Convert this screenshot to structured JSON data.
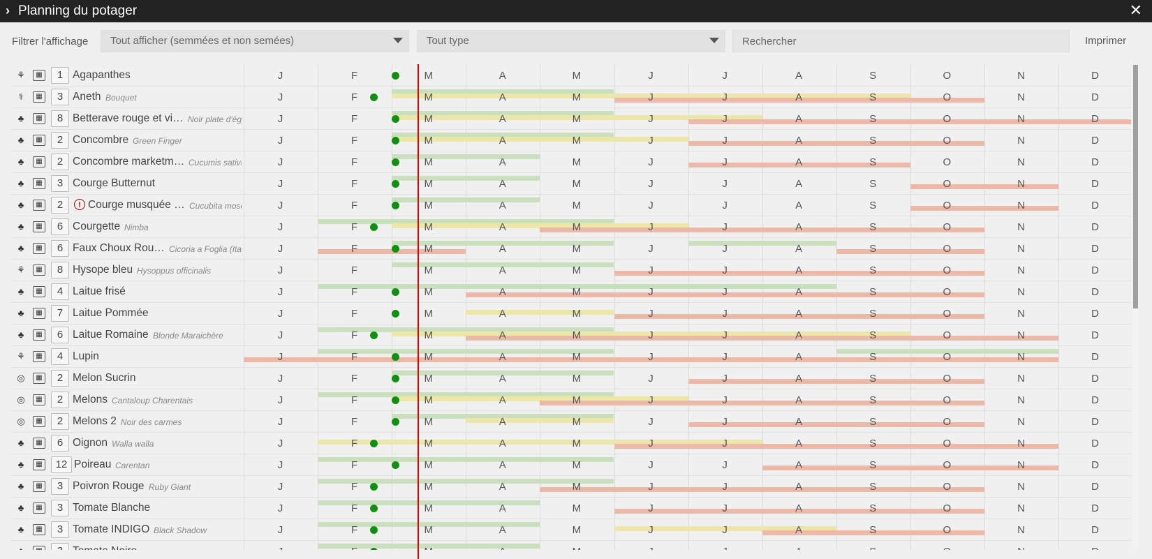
{
  "window": {
    "title": "Planning du potager"
  },
  "toolbar": {
    "filter_label": "Filtrer l'affichage",
    "display_filter": "Tout afficher (semmées et non semées)",
    "type_filter": "Tout type",
    "search_placeholder": "Rechercher",
    "print_label": "Imprimer"
  },
  "months": [
    "J",
    "F",
    "M",
    "A",
    "M",
    "J",
    "J",
    "A",
    "S",
    "O",
    "N",
    "D"
  ],
  "colors": {
    "green": "#c9dfbd",
    "yellow": "#ece6a8",
    "red": "#ecb9a8",
    "dot": "#109010",
    "today_line": "#e00000"
  },
  "icons": {
    "flower": "flower-icon",
    "herb": "herb-icon",
    "veg": "vegetable-icon",
    "melon": "melon-icon",
    "cross": "crossed-vegetable-icon",
    "sheet": "plant-sheet-icon",
    "warn": "warning-icon"
  },
  "rows": [
    {
      "type": "flower",
      "qty": "1",
      "name": "Agapanthes",
      "variety": "",
      "dot": 2,
      "bars": []
    },
    {
      "type": "herb",
      "qty": "3",
      "name": "Aneth",
      "variety": "Bouquet",
      "dot": 1,
      "bars": [
        [
          "g",
          2,
          5,
          1
        ],
        [
          "y",
          2,
          9,
          2
        ],
        [
          "r",
          5,
          10,
          3
        ]
      ]
    },
    {
      "type": "veg",
      "qty": "8",
      "name": "Betterave rouge et vi…",
      "variety": "Noir plate d'égypte",
      "dot": 2,
      "bars": [
        [
          "g",
          2,
          5,
          1
        ],
        [
          "y",
          2,
          7,
          2
        ],
        [
          "r",
          6,
          12,
          3
        ]
      ]
    },
    {
      "type": "veg",
      "qty": "2",
      "name": "Concombre",
      "variety": "Green Finger",
      "dot": 2,
      "bars": [
        [
          "g",
          2,
          5,
          1
        ],
        [
          "y",
          2,
          6,
          2
        ],
        [
          "r",
          6,
          10,
          3
        ]
      ]
    },
    {
      "type": "veg",
      "qty": "2",
      "name": "Concombre marketm…",
      "variety": "Cucumis sativus",
      "dot": 2,
      "bars": [
        [
          "g",
          2,
          4,
          1
        ],
        [
          "r",
          6,
          9,
          3
        ]
      ]
    },
    {
      "type": "veg",
      "qty": "3",
      "name": "Courge Butternut",
      "variety": "",
      "dot": 2,
      "bars": [
        [
          "g",
          2,
          4,
          1
        ],
        [
          "r",
          9,
          11,
          3
        ]
      ]
    },
    {
      "type": "veg",
      "qty": "2",
      "name": "Courge musquée …",
      "variety": "Cucubita moschata",
      "warn": true,
      "dot": 2,
      "bars": [
        [
          "g",
          2,
          4,
          1
        ],
        [
          "r",
          9,
          11,
          3
        ]
      ]
    },
    {
      "type": "veg",
      "qty": "6",
      "name": "Courgette",
      "variety": "Nimba",
      "dot": 1,
      "bars": [
        [
          "g",
          1,
          5,
          1
        ],
        [
          "y",
          2,
          6,
          2
        ],
        [
          "r",
          4,
          10,
          3
        ]
      ]
    },
    {
      "type": "veg",
      "qty": "6",
      "name": "Faux Choux Rou…",
      "variety": "Cicoria a Foglia (Italie)",
      "dot": 2,
      "bars": [
        [
          "g",
          2,
          5,
          1
        ],
        [
          "g",
          6,
          8,
          1
        ],
        [
          "r",
          1,
          3,
          3
        ],
        [
          "r",
          8,
          10,
          3
        ]
      ]
    },
    {
      "type": "flower",
      "qty": "8",
      "name": "Hysope bleu",
      "variety": "Hysoppus officinalis",
      "dot": 0,
      "bars": [
        [
          "g",
          2,
          5,
          1
        ],
        [
          "r",
          5,
          10,
          3
        ]
      ]
    },
    {
      "type": "veg",
      "qty": "4",
      "name": "Laitue frisé",
      "variety": "",
      "dot": 2,
      "bars": [
        [
          "g",
          1,
          8,
          1
        ],
        [
          "r",
          3,
          10,
          3
        ]
      ]
    },
    {
      "type": "cross",
      "qty": "7",
      "name": "Laitue Pommée",
      "variety": "",
      "dot": 2,
      "bars": [
        [
          "y",
          3,
          5,
          2
        ],
        [
          "r",
          5,
          10,
          3
        ]
      ]
    },
    {
      "type": "veg",
      "qty": "6",
      "name": "Laitue Romaine",
      "variety": "Blonde Maraichère",
      "dot": 1,
      "bars": [
        [
          "g",
          1,
          5,
          1
        ],
        [
          "y",
          2,
          9,
          2
        ],
        [
          "r",
          3,
          11,
          3
        ]
      ]
    },
    {
      "type": "flower",
      "qty": "4",
      "name": "Lupin",
      "variety": "",
      "dot": 2,
      "bars": [
        [
          "g",
          1,
          5,
          1
        ],
        [
          "g",
          8,
          11,
          1
        ],
        [
          "r",
          0,
          11,
          3
        ]
      ]
    },
    {
      "type": "melon",
      "qty": "2",
      "name": "Melon Sucrin",
      "variety": "",
      "dot": 2,
      "bars": [
        [
          "g",
          2,
          5,
          1
        ],
        [
          "r",
          6,
          10,
          3
        ]
      ]
    },
    {
      "type": "melon",
      "qty": "2",
      "name": "Melons",
      "variety": "Cantaloup Charentais",
      "dot": 2,
      "bars": [
        [
          "g",
          1,
          5,
          1
        ],
        [
          "y",
          2,
          6,
          2
        ],
        [
          "r",
          4,
          10,
          3
        ]
      ]
    },
    {
      "type": "melon",
      "qty": "2",
      "name": "Melons 2",
      "variety": "Noir des carmes",
      "dot": 2,
      "bars": [
        [
          "g",
          2,
          5,
          1
        ],
        [
          "y",
          3,
          5,
          2
        ],
        [
          "r",
          6,
          10,
          3
        ]
      ]
    },
    {
      "type": "veg",
      "qty": "6",
      "name": "Oignon",
      "variety": "Walla walla",
      "dot": 1,
      "bars": [
        [
          "y",
          1,
          7,
          2
        ],
        [
          "r",
          5,
          11,
          3
        ]
      ]
    },
    {
      "type": "veg",
      "qty": "12",
      "name": "Poireau",
      "variety": "Carentan",
      "dot": 2,
      "bars": [
        [
          "g",
          1,
          5,
          1
        ],
        [
          "r",
          7,
          11,
          3
        ]
      ]
    },
    {
      "type": "veg",
      "qty": "3",
      "name": "Poivron Rouge",
      "variety": "Ruby Giant",
      "dot": 1,
      "bars": [
        [
          "g",
          1,
          5,
          1
        ],
        [
          "r",
          4,
          10,
          3
        ]
      ]
    },
    {
      "type": "veg",
      "qty": "3",
      "name": "Tomate Blanche",
      "variety": "",
      "dot": 1,
      "bars": [
        [
          "g",
          1,
          4,
          1
        ],
        [
          "r",
          5,
          10,
          3
        ]
      ]
    },
    {
      "type": "veg",
      "qty": "3",
      "name": "Tomate INDIGO",
      "variety": "Black Shadow",
      "dot": 1,
      "bars": [
        [
          "g",
          1,
          4,
          1
        ],
        [
          "y",
          5,
          8,
          2
        ],
        [
          "r",
          7,
          10,
          3
        ]
      ]
    },
    {
      "type": "veg",
      "qty": "3",
      "name": "Tomate Noire",
      "variety": "",
      "dot": 1,
      "bars": [
        [
          "g",
          1,
          4,
          1
        ]
      ]
    }
  ]
}
